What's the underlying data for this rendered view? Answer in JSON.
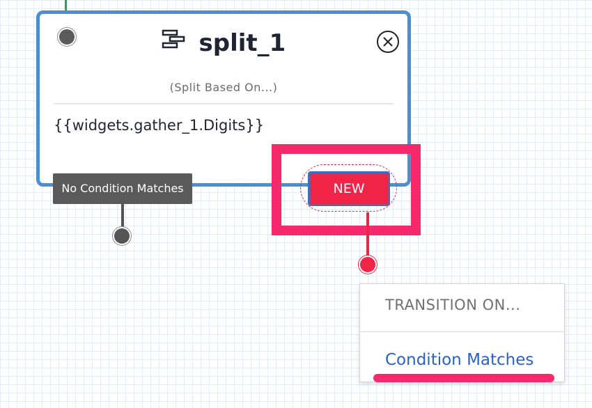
{
  "node": {
    "title": "split_1",
    "subtitle": "(Split Based On...)",
    "expression": "{{widgets.gather_1.Digits}}",
    "icon": "split-icon"
  },
  "transitions": {
    "no_condition_label": "No Condition Matches",
    "new_button_label": "NEW"
  },
  "menu": {
    "header": "TRANSITION ON...",
    "items": [
      {
        "label": "Condition Matches"
      }
    ]
  },
  "colors": {
    "node_border": "#4a8fd0",
    "highlight": "#f5296c",
    "new_button": "#ef2447",
    "menu_link": "#2a62c4"
  }
}
